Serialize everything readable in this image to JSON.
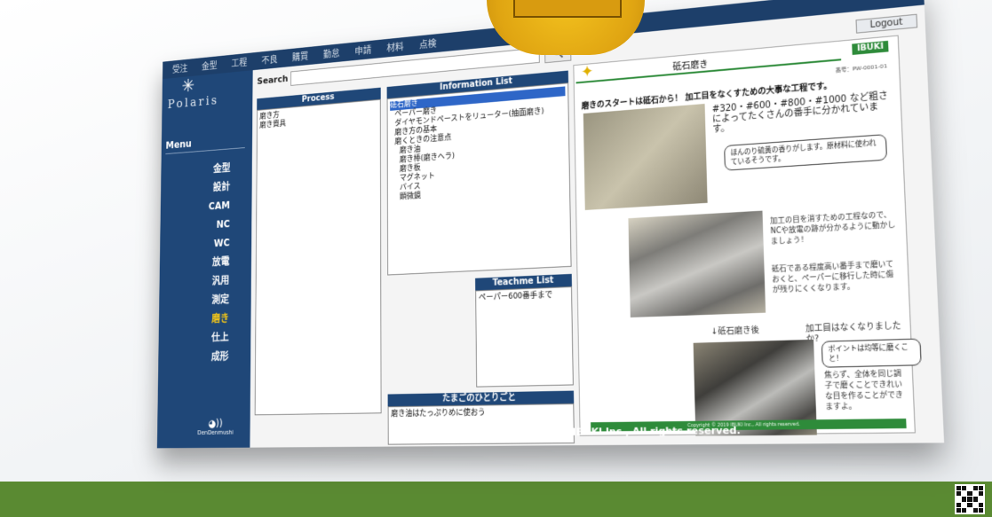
{
  "topnav": {
    "items": [
      "受注",
      "金型",
      "工程",
      "不良",
      "購買",
      "勤怠",
      "申請",
      "材料",
      "点検"
    ],
    "logout": "Logout",
    "min": "‒",
    "close": "×"
  },
  "sidebar": {
    "logo": "Polaris",
    "menu_title": "Menu",
    "items": [
      {
        "label": "金型",
        "active": false
      },
      {
        "label": "設計",
        "active": false
      },
      {
        "label": "CAM",
        "active": false
      },
      {
        "label": "NC",
        "active": false
      },
      {
        "label": "WC",
        "active": false
      },
      {
        "label": "放電",
        "active": false
      },
      {
        "label": "汎用",
        "active": false
      },
      {
        "label": "測定",
        "active": false
      },
      {
        "label": "磨き",
        "active": true
      },
      {
        "label": "仕上",
        "active": false
      },
      {
        "label": "成形",
        "active": false
      }
    ],
    "footer": "DenDenmushi"
  },
  "search": {
    "label": "Search",
    "value": "",
    "button": "🔍"
  },
  "process": {
    "header": "Process",
    "items": [
      "磨き方",
      "磨き資具"
    ]
  },
  "info_list": {
    "header": "Information List",
    "items": [
      {
        "text": "砥石磨き",
        "selected": true,
        "indent": 0
      },
      {
        "text": "ペーパー磨き",
        "selected": false,
        "indent": 1
      },
      {
        "text": "ダイヤモンドペーストをリューター(抽面磨き)",
        "selected": false,
        "indent": 1
      },
      {
        "text": "磨き方の基本",
        "selected": false,
        "indent": 1
      },
      {
        "text": "磨くときの注意点",
        "selected": false,
        "indent": 1
      },
      {
        "text": "磨き油",
        "selected": false,
        "indent": 2
      },
      {
        "text": "磨き棒(磨きヘラ)",
        "selected": false,
        "indent": 2
      },
      {
        "text": "磨き板",
        "selected": false,
        "indent": 2
      },
      {
        "text": "マグネット",
        "selected": false,
        "indent": 2
      },
      {
        "text": "バイス",
        "selected": false,
        "indent": 2
      },
      {
        "text": "顕微鏡",
        "selected": false,
        "indent": 2
      }
    ]
  },
  "teachme": {
    "header": "Teachme List",
    "items": [
      "ペーパー600番手まで"
    ]
  },
  "hitokoto": {
    "header": "たまごのひとりごと",
    "text": "磨き油はたっぷりめに使おう"
  },
  "detail": {
    "title": "砥石磨き",
    "badge": "IBUKI",
    "doc_no": "番号：PW-0001-01",
    "headline": "磨きのスタートは砥石から！ 加工目をなくすための大事な工程です。",
    "cap1": "#320・#600・#800・#1000 など粗さによってたくさんの番手に分かれています。",
    "bubble1": "ほんのり硫黄の香りがします。原材料に使われているそうです。",
    "cap2": "加工の目を消すための工程なので、NCや放電の跡が分かるように動かしましょう！",
    "cap3": "砥石である程度高い番手まで磨いておくと、ペーパーに移行した時に傷が残りにくくなります。",
    "after_label": "↓砥石磨き後",
    "q": "加工目はなくなりましたか?",
    "bubble2": "ポイントは均等に磨くこと！",
    "bubble3": "焦らず、全体を同じ調子で磨くことできれいな目を作ることができますよ。",
    "footer": "Copyright © 2019 IBUKI Inc., All rights reserved."
  },
  "copyright": "Copyright 2019© IBUKI Inc., All rights reserved."
}
